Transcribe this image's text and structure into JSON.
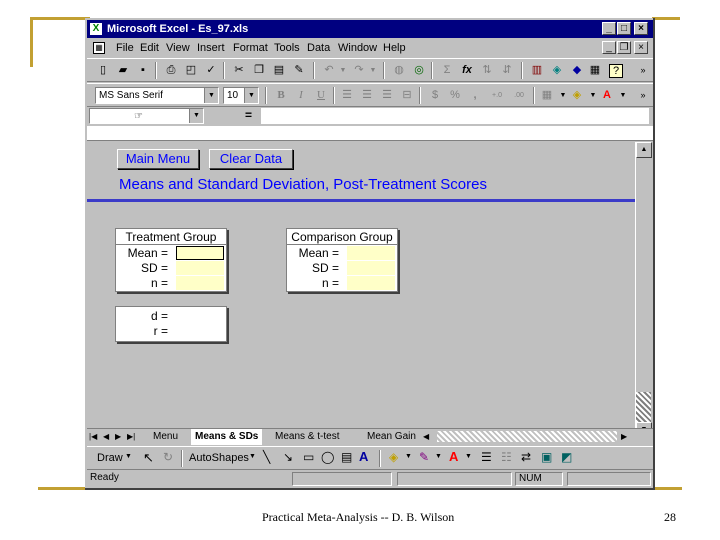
{
  "window": {
    "title": "Microsoft Excel - Es_97.xls"
  },
  "menu": [
    "File",
    "Edit",
    "View",
    "Insert",
    "Format",
    "Tools",
    "Data",
    "Window",
    "Help"
  ],
  "formatting": {
    "font": "MS Sans Serif",
    "size": "10",
    "bold": "B",
    "italic": "I",
    "underline": "U",
    "currency": "$",
    "percent": "%",
    "comma": ",",
    "increase_decimal": "+.0",
    "decrease_decimal": ".00"
  },
  "toolbar": {
    "sum": "Σ",
    "function": "fx",
    "help": "?"
  },
  "formula_bar": {
    "cell_ref": "",
    "equals": "="
  },
  "sheet": {
    "main_menu_button": "Main Menu",
    "clear_data_button": "Clear Data",
    "heading": "Means and Standard Deviation, Post-Treatment Scores",
    "treatment": {
      "title": "Treatment Group",
      "labels": [
        "Mean =",
        "SD =",
        "n ="
      ]
    },
    "comparison": {
      "title": "Comparison Group",
      "labels": [
        "Mean =",
        "SD =",
        "n ="
      ]
    },
    "results": {
      "labels": [
        "d =",
        "r ="
      ]
    }
  },
  "tabs": [
    "Menu",
    "Means & SDs",
    "Means & t-test",
    "Mean Gain"
  ],
  "active_tab": "Means & SDs",
  "draw_toolbar": {
    "draw": "Draw",
    "autoshapes": "AutoShapes"
  },
  "status": {
    "text": "Ready",
    "num": "NUM"
  },
  "footer": {
    "caption": "Practical Meta-Analysis -- D. B. Wilson",
    "page": "28"
  },
  "colors": {
    "title_bar": "#000080",
    "sheet_text": "#0000ff",
    "input_fill": "#ffffc8",
    "slide_accent": "#c2a032"
  }
}
